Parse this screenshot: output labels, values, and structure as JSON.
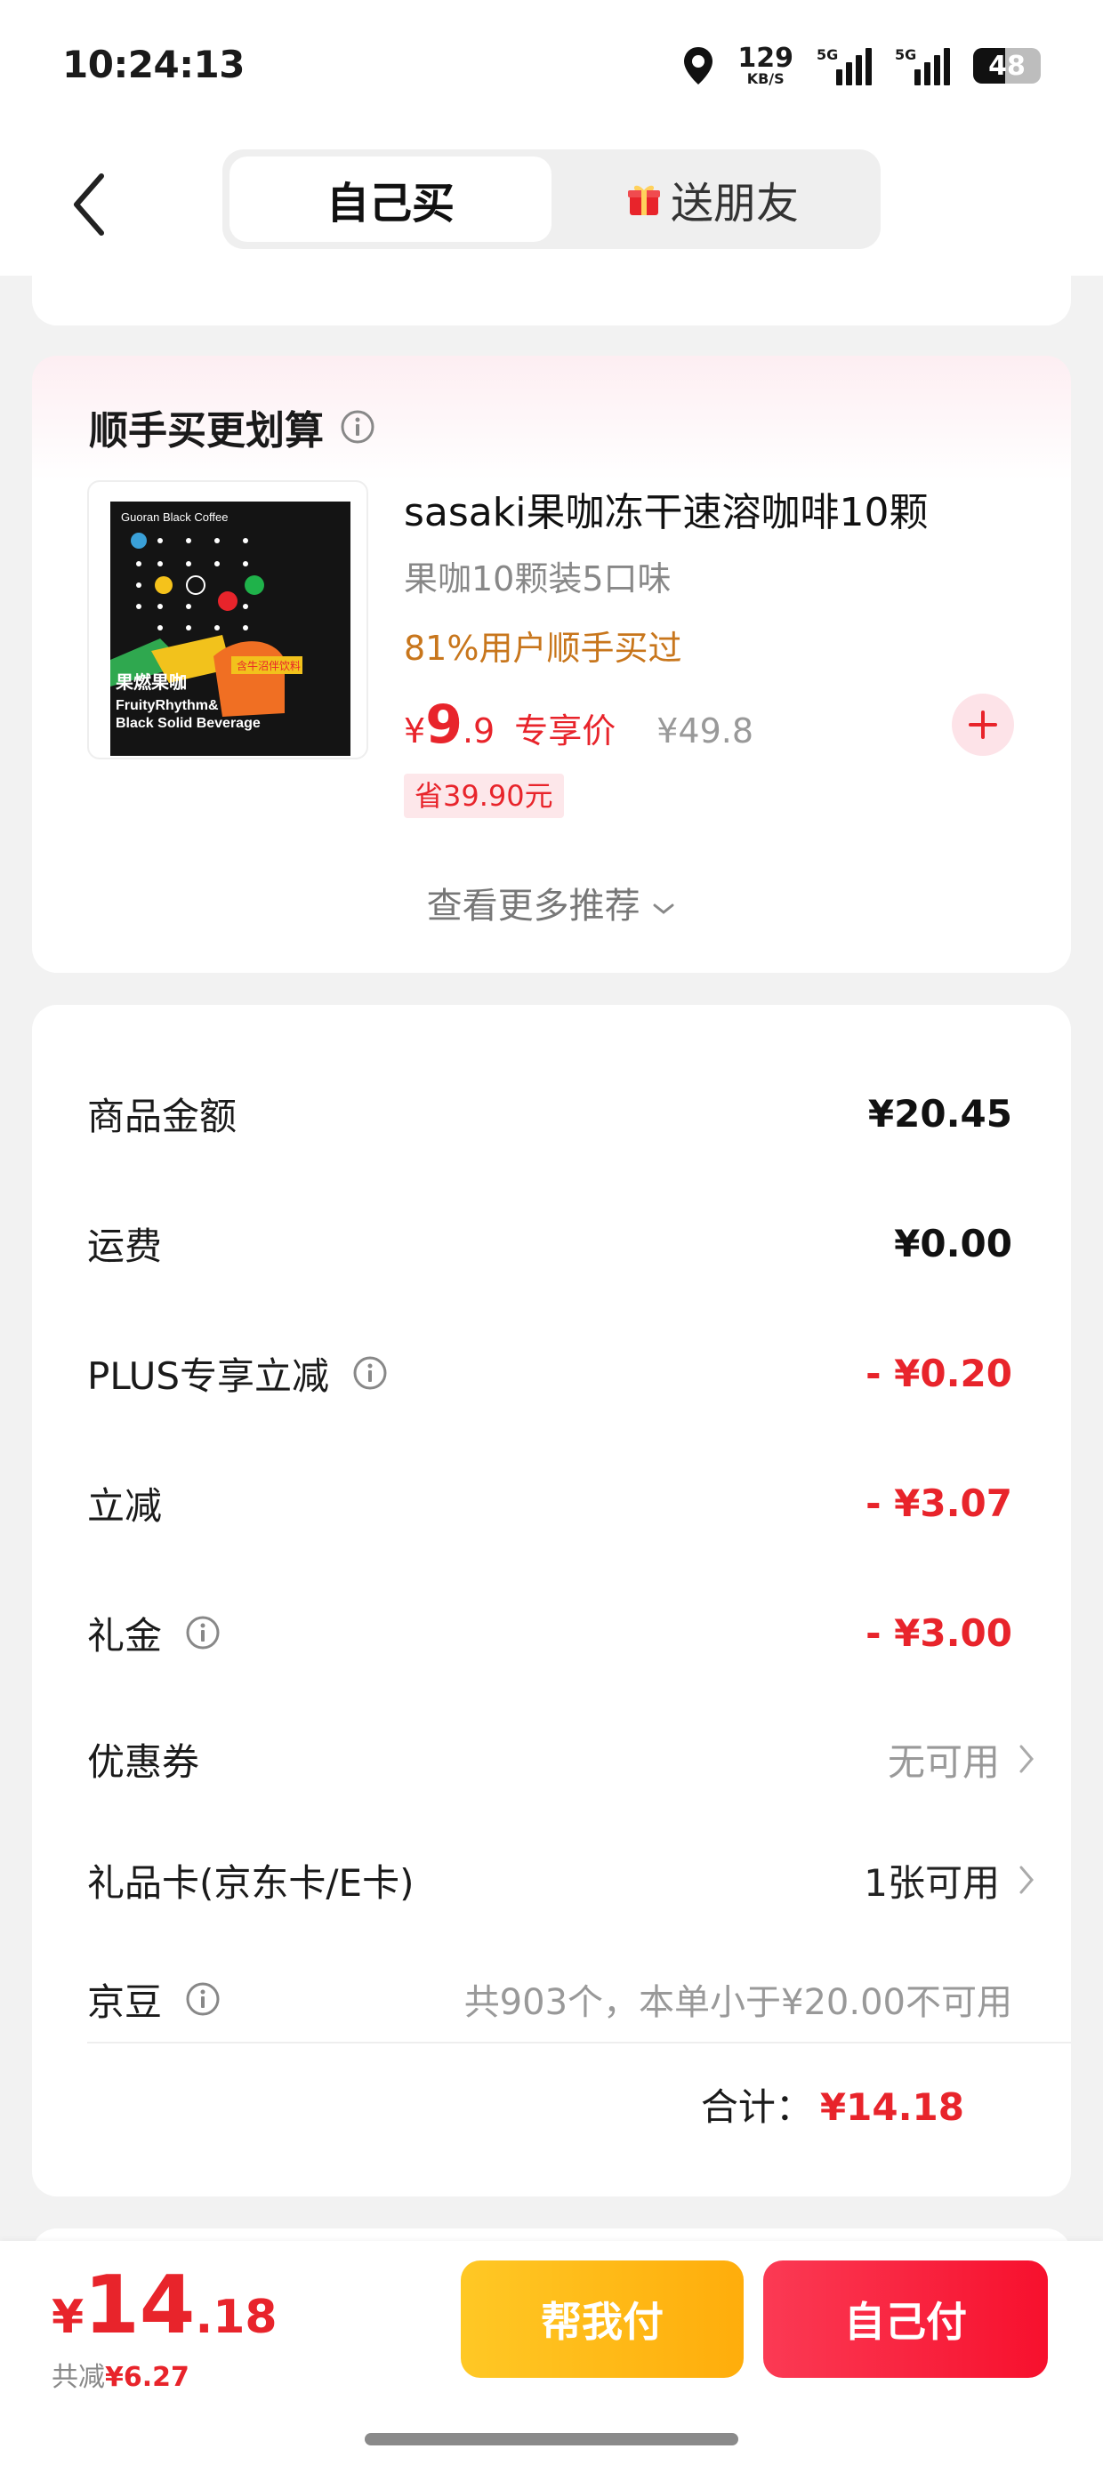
{
  "status_bar": {
    "time": "10:24:13",
    "net_speed": "129",
    "net_unit": "KB/S",
    "signal1_label": "5G",
    "signal2_label": "5G",
    "battery": "48",
    "battery_level": 0.48
  },
  "nav": {
    "tab_self": "自己买",
    "tab_gift": "送朋友"
  },
  "recommend": {
    "title": "顺手买更划算",
    "product": {
      "name": "sasaki果咖冻干速溶咖啡10颗",
      "spec": "果咖10颗装5口味",
      "social_proof": "81%用户顺手买过",
      "price_symbol": "¥",
      "price_int": "9",
      "price_dec": ".9",
      "price_tag": "专享价",
      "original_price": "¥49.8",
      "save_label": "省39.90元",
      "thumb_brand": "Guoran Black Coffee",
      "thumb_cn": "果燃果咖",
      "thumb_en1": "FruityRhythm&",
      "thumb_en2": "Black Solid Beverage",
      "thumb_side": "含牛沼伴饮料"
    },
    "more": "查看更多推荐"
  },
  "fees": {
    "rows": [
      {
        "label": "商品金额",
        "value": "¥20.45"
      },
      {
        "label": "运费",
        "value": "¥0.00"
      },
      {
        "label": "PLUS专享立减",
        "value": "- ¥0.20"
      },
      {
        "label": "立减",
        "value": "- ¥3.07"
      },
      {
        "label": "礼金",
        "value": "- ¥3.00"
      },
      {
        "label": "优惠券",
        "value": "无可用"
      },
      {
        "label": "礼品卡(京东卡/E卡)",
        "value": "1张可用"
      },
      {
        "label": "京豆",
        "value": "共903个，本单小于¥20.00不可用"
      }
    ],
    "total_label": "合计：",
    "total_value": "¥14.18"
  },
  "bottom": {
    "price_symbol": "¥",
    "price_int": "14",
    "price_dec": ".18",
    "saved_label": "共减",
    "saved_value": "¥6.27",
    "help_pay": "帮我付",
    "self_pay": "自己付"
  },
  "colors": {
    "accent_red": "#e8242b",
    "help_yellow": "#ffb813",
    "self_red": "#f7102d",
    "social_orange": "#c8761c"
  }
}
